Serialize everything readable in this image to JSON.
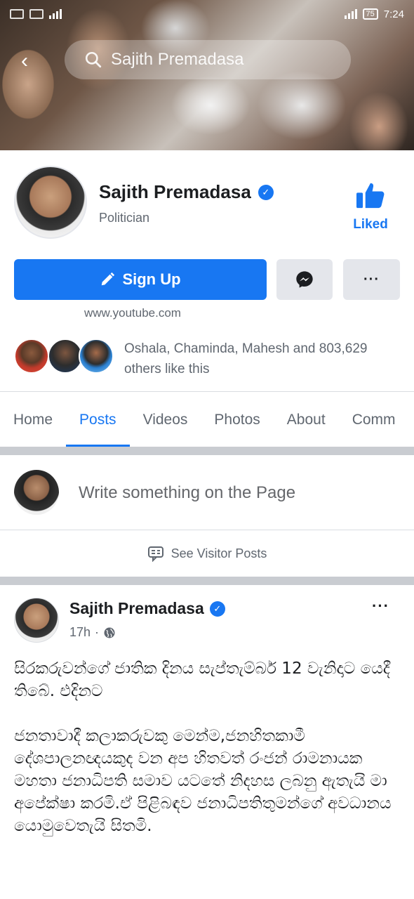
{
  "status_bar": {
    "time": "7:24",
    "battery": "75"
  },
  "search": {
    "query": "Sajith Premadasa"
  },
  "page": {
    "name": "Sajith Premadasa",
    "category": "Politician",
    "liked_label": "Liked",
    "website": "www.youtube.com"
  },
  "actions": {
    "primary_label": "Sign Up",
    "more_label": "···"
  },
  "friends_like": {
    "text": "Oshala, Chaminda, Mahesh and 803,629 others like this"
  },
  "tabs": [
    {
      "label": "Home"
    },
    {
      "label": "Posts"
    },
    {
      "label": "Videos"
    },
    {
      "label": "Photos"
    },
    {
      "label": "About"
    },
    {
      "label": "Comm"
    }
  ],
  "active_tab": "Posts",
  "composer": {
    "placeholder": "Write something on the Page"
  },
  "visitor_posts": {
    "label": "See Visitor Posts"
  },
  "post": {
    "author": "Sajith Premadasa",
    "time": "17h",
    "menu": "···",
    "paragraphs": [
      "සිරකරුවන්ගේ ජාතික දිනය සැප්තැම්බර් 12 වැනිදාට යෙදී තිබේ. එදිනට",
      "ජනතාවාදී කලාකරුවකු මෙන්ම,ජනහිතකාමී දේශපාලනඥයකුද වන  අප හිතවත් රංජන් රාමනායක මහතා ජනාධිපති සමාව යටතේ නිදහස ලබනු ඇතැයි මා අපේක්ෂා කරමි.ඒ පිළිබඳව ජනාධිපතිතුමන්ගේ අවධානය යොමුවෙතැයි සිතමි."
    ]
  },
  "colors": {
    "accent": "#1877f2",
    "grey_button": "#e4e6eb",
    "text_secondary": "#606770"
  },
  "icons": [
    "search-icon",
    "back-arrow-icon",
    "verified-icon",
    "like-thumb-icon",
    "pencil-icon",
    "messenger-icon",
    "more-icon",
    "visitor-posts-icon",
    "globe-icon"
  ]
}
